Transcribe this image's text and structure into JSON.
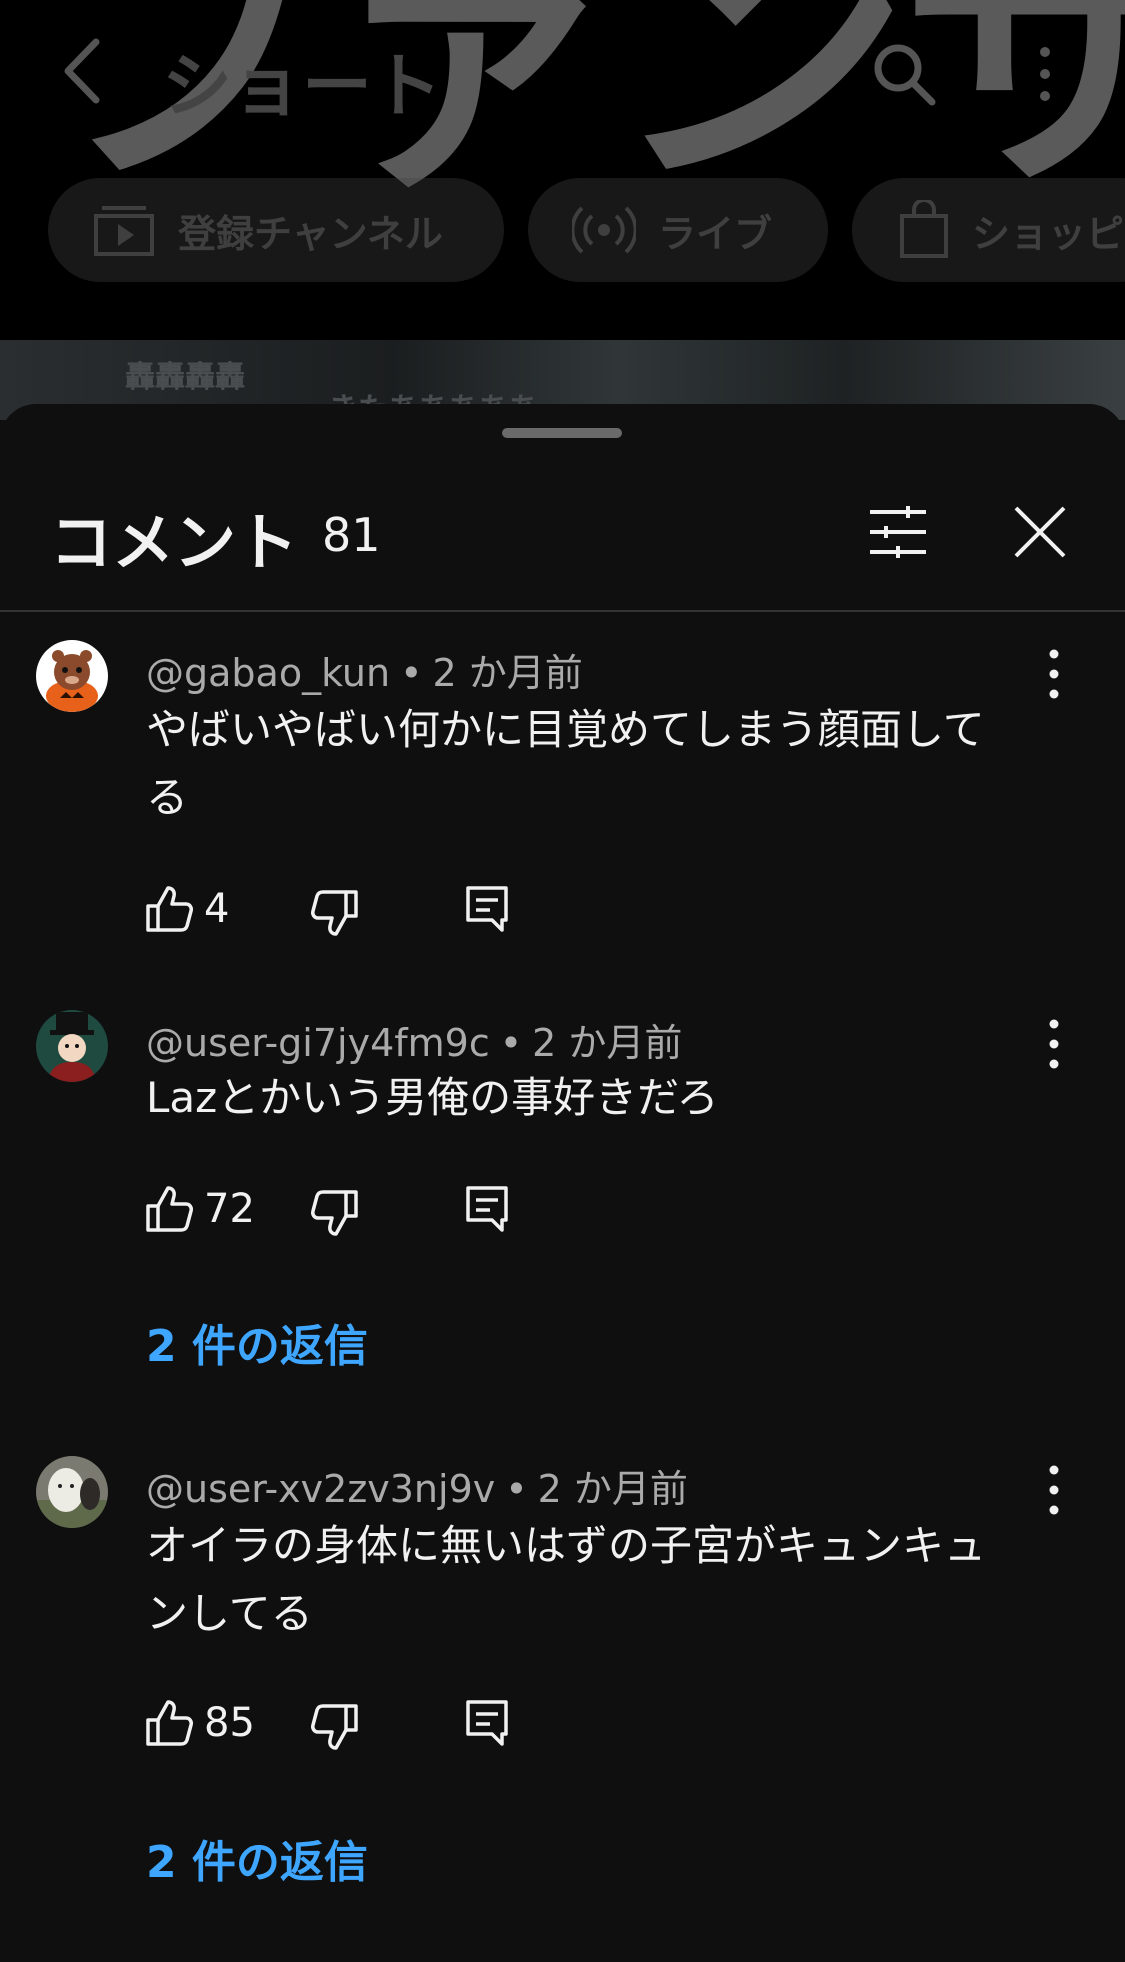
{
  "background": {
    "big_text": "ファンサ",
    "title": "ショート",
    "chips": [
      {
        "label": "登録チャンネル",
        "icon": "subscriptions-icon"
      },
      {
        "label": "ライブ",
        "icon": "live-icon"
      },
      {
        "label": "ショッピ",
        "icon": "shopping-bag-icon"
      }
    ],
    "video_caption_1": "轟轟轟轟",
    "video_caption_2": "きたあああああ"
  },
  "sheet": {
    "title": "コメント",
    "count": "81",
    "filter_icon": "filter-icon",
    "close_icon": "close-icon"
  },
  "comments": [
    {
      "author": "@gabao_kun",
      "time": "2 か月前",
      "text": "やばいやばい何かに目覚めてしまう顔面してる",
      "likes": "4",
      "replies": ""
    },
    {
      "author": "@user-gi7jy4fm9c",
      "time": "2 か月前",
      "text": "Lazとかいう男俺の事好きだろ",
      "likes": "72",
      "replies": "2 件の返信"
    },
    {
      "author": "@user-xv2zv3nj9v",
      "time": "2 か月前",
      "text": "オイラの身体に無いはずの子宮がキュンキュンしてる",
      "likes": "85",
      "replies": "2 件の返信"
    }
  ],
  "colors": {
    "background": "#0f0f0f",
    "text": "#f1f1f1",
    "meta": "#aaaaaa",
    "link": "#3ea6ff"
  }
}
